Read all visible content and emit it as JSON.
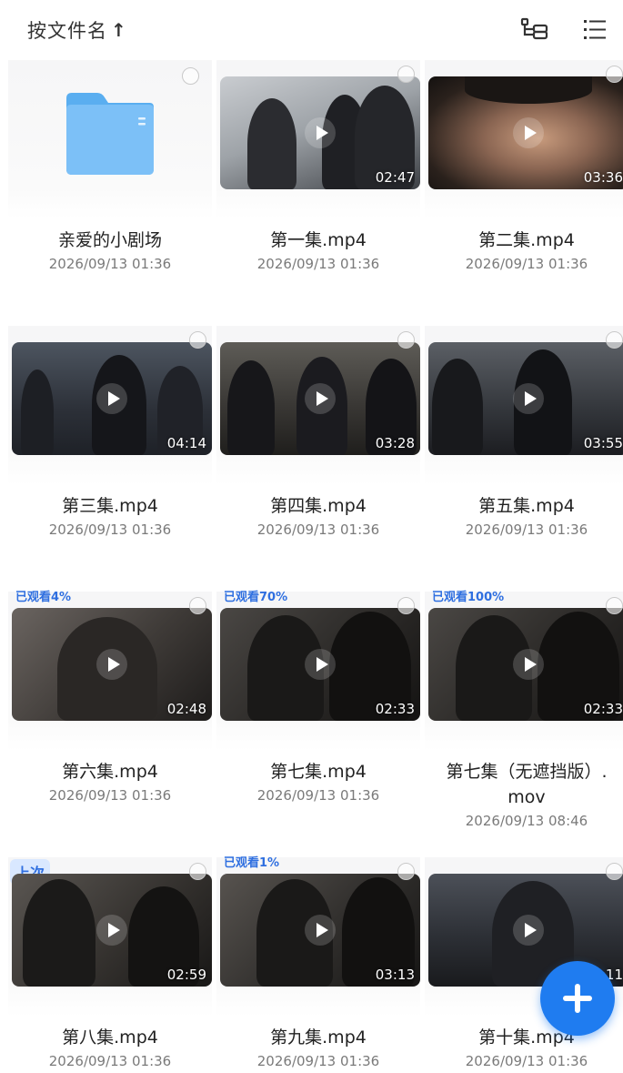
{
  "toolbar": {
    "sort_label": "按文件名",
    "sort_arrow": "↑",
    "tree_icon": "tree-structure-icon",
    "list_icon": "list-view-icon"
  },
  "colors": {
    "accent": "#1f7cf0",
    "watched_text": "#2f6fe0"
  },
  "items": [
    {
      "type": "folder",
      "name": "亲爱的小剧场",
      "date": "2026/09/13 01:36"
    },
    {
      "type": "video",
      "name": "第一集.mp4",
      "date": "2026/09/13 01:36",
      "duration": "02:47"
    },
    {
      "type": "video",
      "name": "第二集.mp4",
      "date": "2026/09/13 01:36",
      "duration": "03:36"
    },
    {
      "type": "video",
      "name": "第三集.mp4",
      "date": "2026/09/13 01:36",
      "duration": "04:14"
    },
    {
      "type": "video",
      "name": "第四集.mp4",
      "date": "2026/09/13 01:36",
      "duration": "03:28"
    },
    {
      "type": "video",
      "name": "第五集.mp4",
      "date": "2026/09/13 01:36",
      "duration": "03:55"
    },
    {
      "type": "video",
      "name": "第六集.mp4",
      "date": "2026/09/13 01:36",
      "duration": "02:48",
      "watched": "已观看4%"
    },
    {
      "type": "video",
      "name": "第七集.mp4",
      "date": "2026/09/13 01:36",
      "duration": "02:33",
      "watched": "已观看70%"
    },
    {
      "type": "video",
      "name": "第七集（无遮挡版）.mov",
      "name_line1": "第七集（无遮挡版）.",
      "name_line2": "mov",
      "date": "2026/09/13 08:46",
      "duration": "02:33",
      "watched": "已观看100%"
    },
    {
      "type": "video",
      "name": "第八集.mp4",
      "date": "2026/09/13 01:36",
      "duration": "02:59",
      "badge": "上次"
    },
    {
      "type": "video",
      "name": "第九集.mp4",
      "date": "2026/09/13 01:36",
      "duration": "03:13",
      "watched": "已观看1%"
    },
    {
      "type": "video",
      "name": "第十集.mp4",
      "date": "2026/09/13 01:36",
      "duration": "05:11"
    }
  ],
  "fab": {
    "icon": "plus-icon"
  }
}
